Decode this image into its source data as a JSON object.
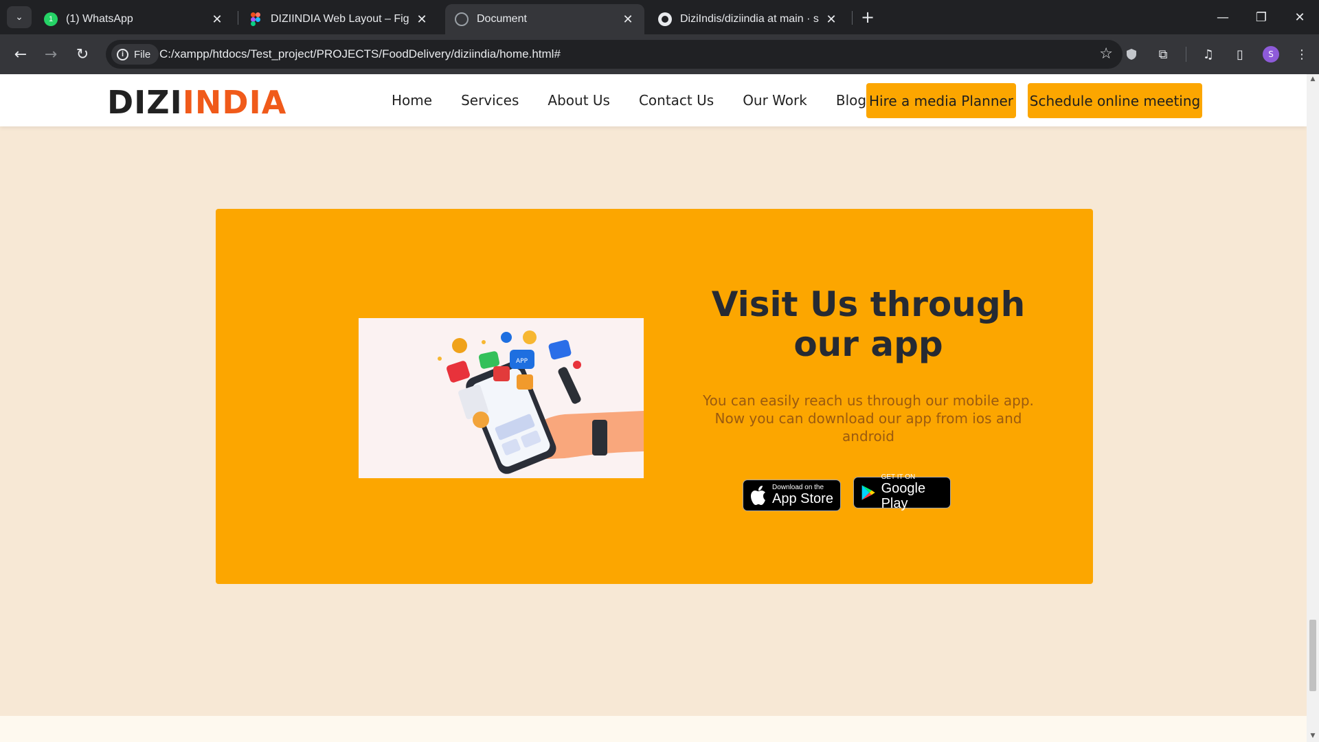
{
  "browser": {
    "tabs": [
      {
        "title": "(1) WhatsApp",
        "icon": "whatsapp-icon"
      },
      {
        "title": "DIZIINDIA Web Layout – Figma",
        "icon": "figma-icon"
      },
      {
        "title": "Document",
        "icon": "globe-icon",
        "active": true
      },
      {
        "title": "DiziIndis/diziindia at main · shar",
        "icon": "github-icon"
      }
    ],
    "chip_label": "File",
    "url": "C:/xampp/htdocs/Test_project/PROJECTS/FoodDelivery/diziindia/home.html#",
    "profile_initial": "S"
  },
  "site": {
    "logo_part1": "DIZI",
    "logo_part2": "INDIA",
    "nav": [
      "Home",
      "Services",
      "About Us",
      "Contact Us",
      "Our Work",
      "Blog"
    ],
    "cta_primary": "Hire a media Planner",
    "cta_secondary": "Schedule online meeting",
    "promo": {
      "title": "Visit Us through our app",
      "description": "You can easily reach us through our mobile app. Now you can download our app from ios and android",
      "app_store_small": "Download on the",
      "app_store_big": "App Store",
      "google_small": "GET IT ON",
      "google_big": "Google Play"
    }
  },
  "colors": {
    "accent": "#fca600",
    "logo_orange": "#f05a1a",
    "page_bg": "#f7e8d5"
  }
}
